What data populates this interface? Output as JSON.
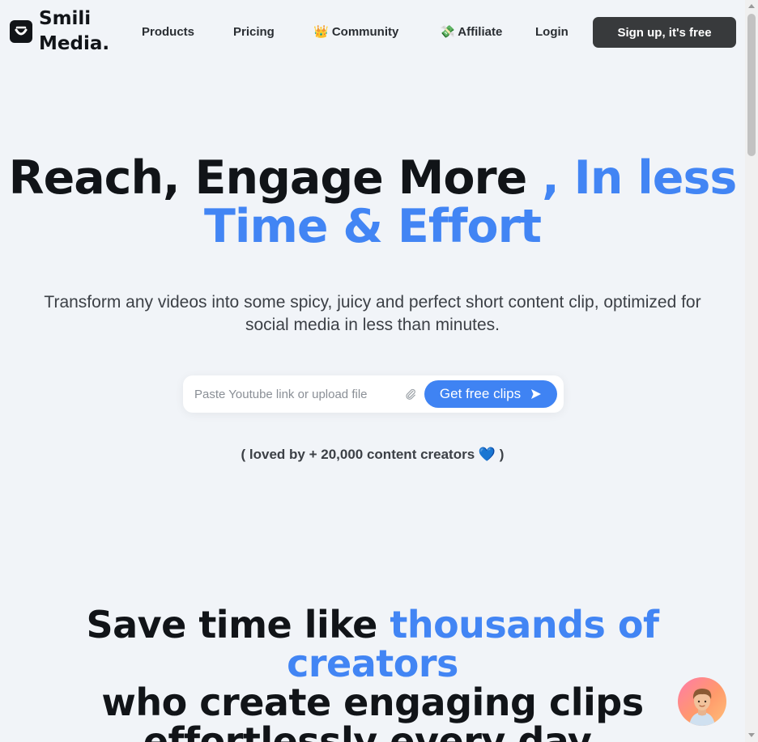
{
  "header": {
    "logo_line1": "Smili",
    "logo_line2": "Media.",
    "nav": {
      "products": "Products",
      "pricing": "Pricing",
      "community": "👑 Community",
      "affiliate": "💸 Affiliate",
      "login": "Login"
    },
    "signup": "Sign up, it's free"
  },
  "hero": {
    "title_dark": "Reach, Engage More ",
    "title_accent_1": ", In less",
    "title_accent_2": "Time & Effort",
    "subtitle_line1": "Transform any videos into some spicy, juicy and perfect short content clip, optimized for",
    "subtitle_line2": "social media in less than minutes.",
    "input_placeholder": "Paste Youtube link or upload file",
    "cta": "Get free clips",
    "loved_prefix": "( loved by + 20,000 content creators ",
    "loved_heart": "💙",
    "loved_suffix": " )"
  },
  "section": {
    "line1_dark": "Save time like ",
    "line1_accent": "thousands of creators",
    "line2": "who create engaging clips",
    "line3": "effortlessly every day."
  },
  "colors": {
    "accent": "#4285f4",
    "background": "#f1f4f8",
    "dark_button": "#383a3c"
  },
  "icons": {
    "logo": "smile-face-icon",
    "attach": "paperclip-icon",
    "send": "send-icon",
    "chat": "support-avatar-icon"
  }
}
